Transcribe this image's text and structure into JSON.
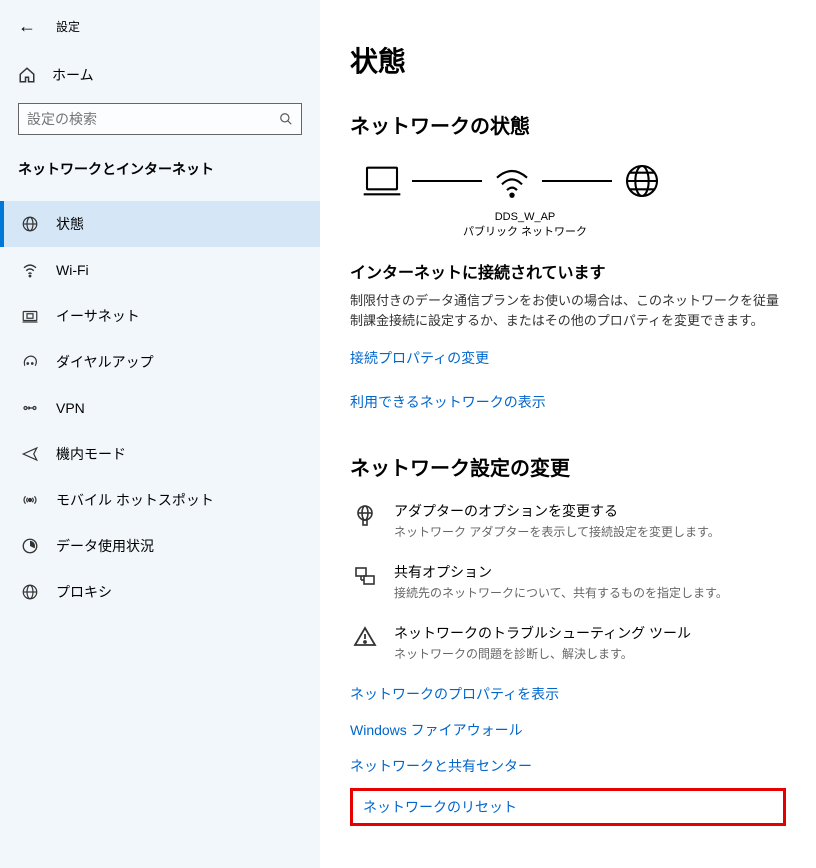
{
  "header": {
    "title": "設定"
  },
  "home": {
    "label": "ホーム"
  },
  "search": {
    "placeholder": "設定の検索"
  },
  "category": "ネットワークとインターネット",
  "nav": [
    {
      "label": "状態",
      "icon": "status"
    },
    {
      "label": "Wi-Fi",
      "icon": "wifi"
    },
    {
      "label": "イーサネット",
      "icon": "ethernet"
    },
    {
      "label": "ダイヤルアップ",
      "icon": "dialup"
    },
    {
      "label": "VPN",
      "icon": "vpn"
    },
    {
      "label": "機内モード",
      "icon": "airplane"
    },
    {
      "label": "モバイル ホットスポット",
      "icon": "hotspot"
    },
    {
      "label": "データ使用状況",
      "icon": "data"
    },
    {
      "label": "プロキシ",
      "icon": "proxy"
    }
  ],
  "main": {
    "page_title": "状態",
    "section1_title": "ネットワークの状態",
    "network_name": "DDS_W_AP",
    "network_type": "パブリック ネットワーク",
    "connected_title": "インターネットに接続されています",
    "connected_desc": "制限付きのデータ通信プランをお使いの場合は、このネットワークを従量制課金接続に設定するか、またはその他のプロパティを変更できます。",
    "link_props": "接続プロパティの変更",
    "link_available": "利用できるネットワークの表示",
    "section2_title": "ネットワーク設定の変更",
    "settings": [
      {
        "title": "アダプターのオプションを変更する",
        "desc": "ネットワーク アダプターを表示して接続設定を変更します。"
      },
      {
        "title": "共有オプション",
        "desc": "接続先のネットワークについて、共有するものを指定します。"
      },
      {
        "title": "ネットワークのトラブルシューティング ツール",
        "desc": "ネットワークの問題を診断し、解決します。"
      }
    ],
    "links": [
      "ネットワークのプロパティを表示",
      "Windows ファイアウォール",
      "ネットワークと共有センター",
      "ネットワークのリセット"
    ]
  }
}
